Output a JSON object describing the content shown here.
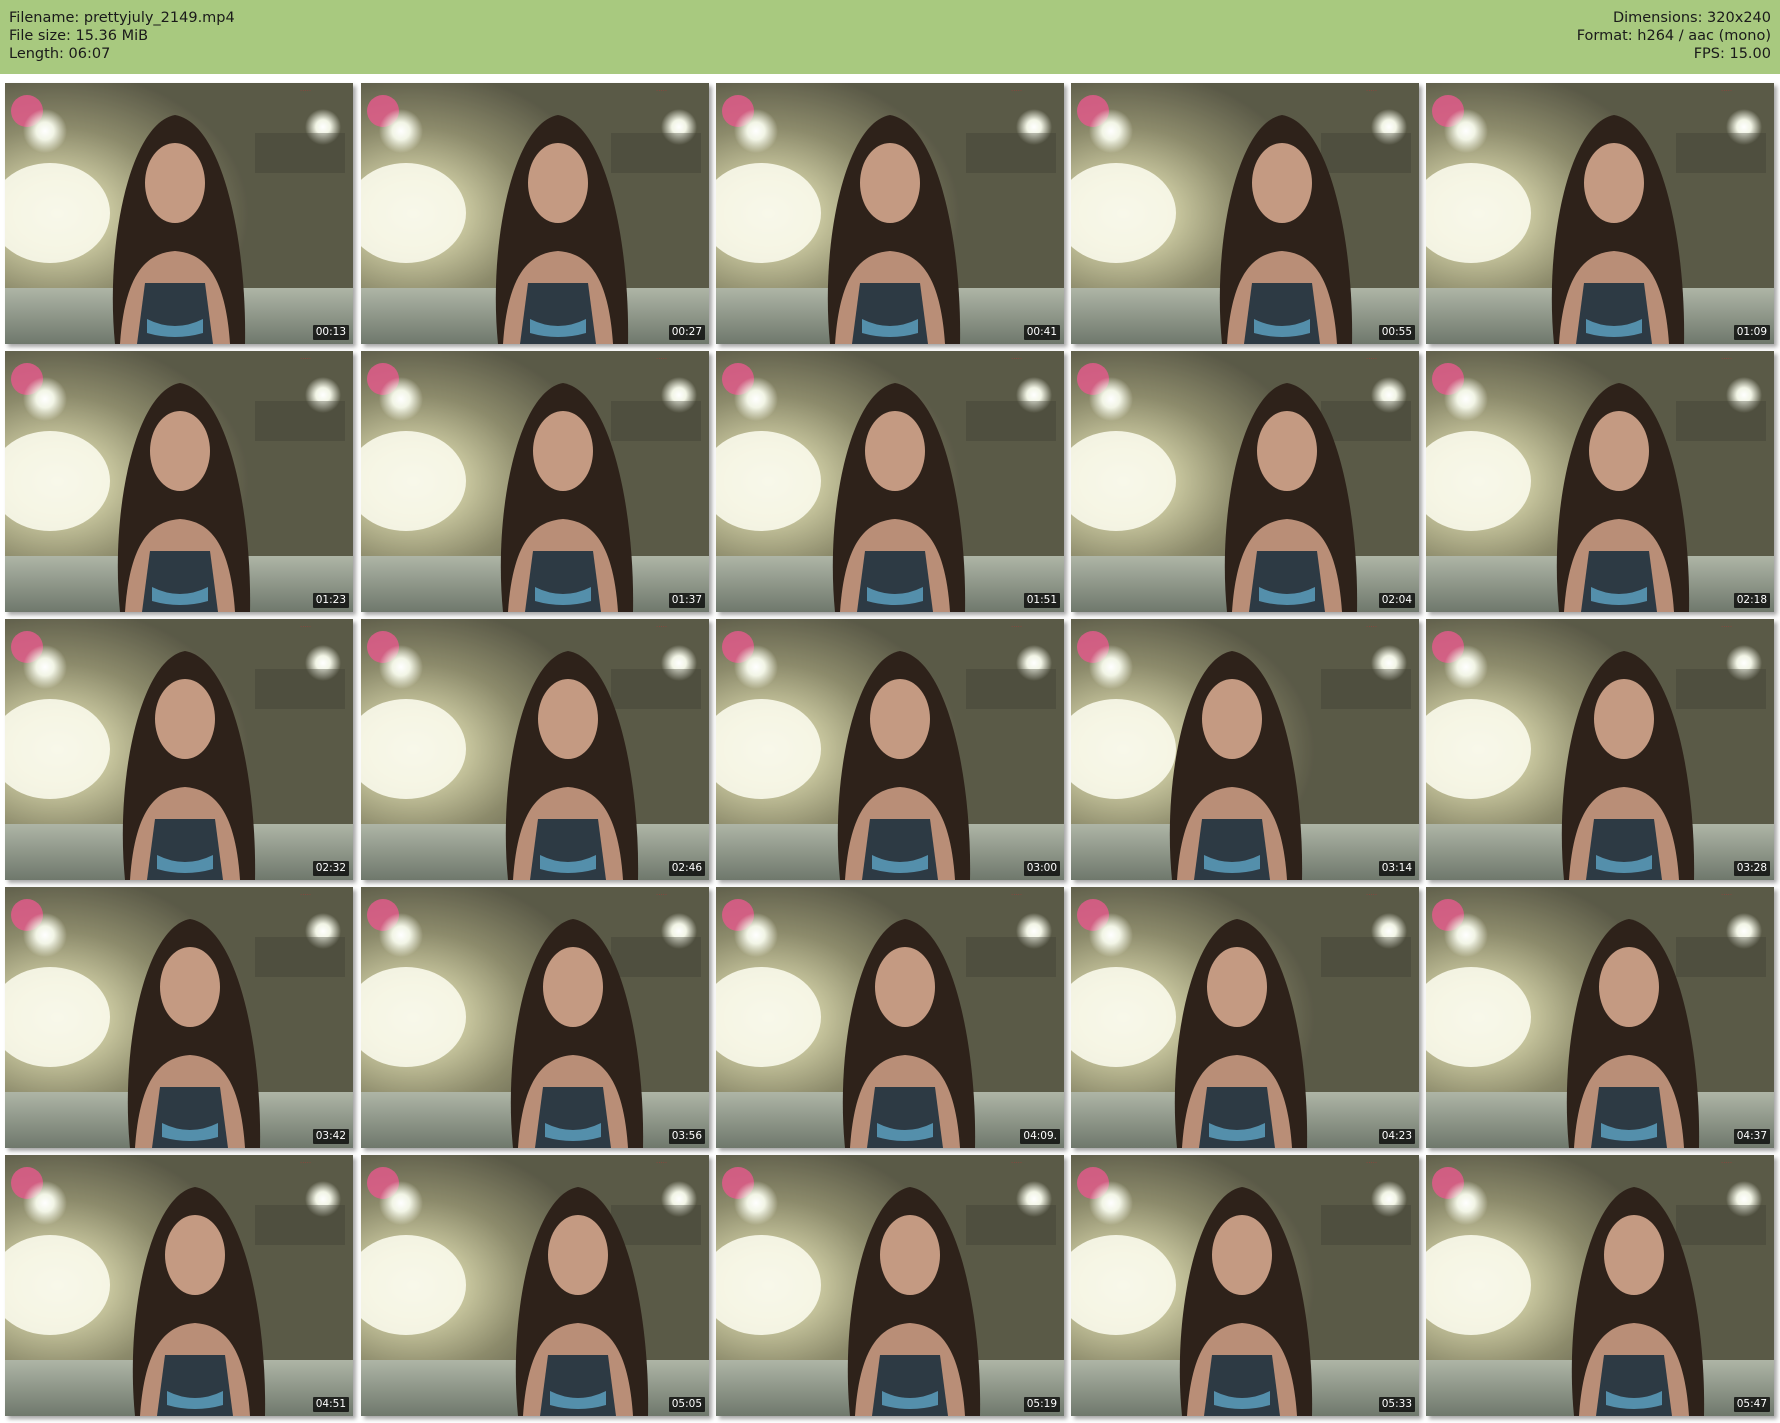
{
  "header": {
    "filename": "Filename: prettyjuly_2149.mp4",
    "file_size": "File size: 15.36 MiB",
    "length": "Length: 06:07",
    "dimensions": "Dimensions: 320x240",
    "format": "Format: h264 / aac (mono)",
    "fps": "FPS: 15.00"
  },
  "colors": {
    "header_bg": "#a8c97f",
    "timestamp_bg": "#000000"
  },
  "thumbnails": [
    {
      "timestamp": "00:13"
    },
    {
      "timestamp": "00:27"
    },
    {
      "timestamp": "00:41"
    },
    {
      "timestamp": "00:55"
    },
    {
      "timestamp": "01:09"
    },
    {
      "timestamp": "01:23"
    },
    {
      "timestamp": "01:37"
    },
    {
      "timestamp": "01:51"
    },
    {
      "timestamp": "02:04"
    },
    {
      "timestamp": "02:18"
    },
    {
      "timestamp": "02:32"
    },
    {
      "timestamp": "02:46"
    },
    {
      "timestamp": "03:00"
    },
    {
      "timestamp": "03:14"
    },
    {
      "timestamp": "03:28"
    },
    {
      "timestamp": "03:42"
    },
    {
      "timestamp": "03:56"
    },
    {
      "timestamp": "04:09."
    },
    {
      "timestamp": "04:23"
    },
    {
      "timestamp": "04:37"
    },
    {
      "timestamp": "04:51"
    },
    {
      "timestamp": "05:05"
    },
    {
      "timestamp": "05:19"
    },
    {
      "timestamp": "05:33"
    },
    {
      "timestamp": "05:47"
    }
  ]
}
